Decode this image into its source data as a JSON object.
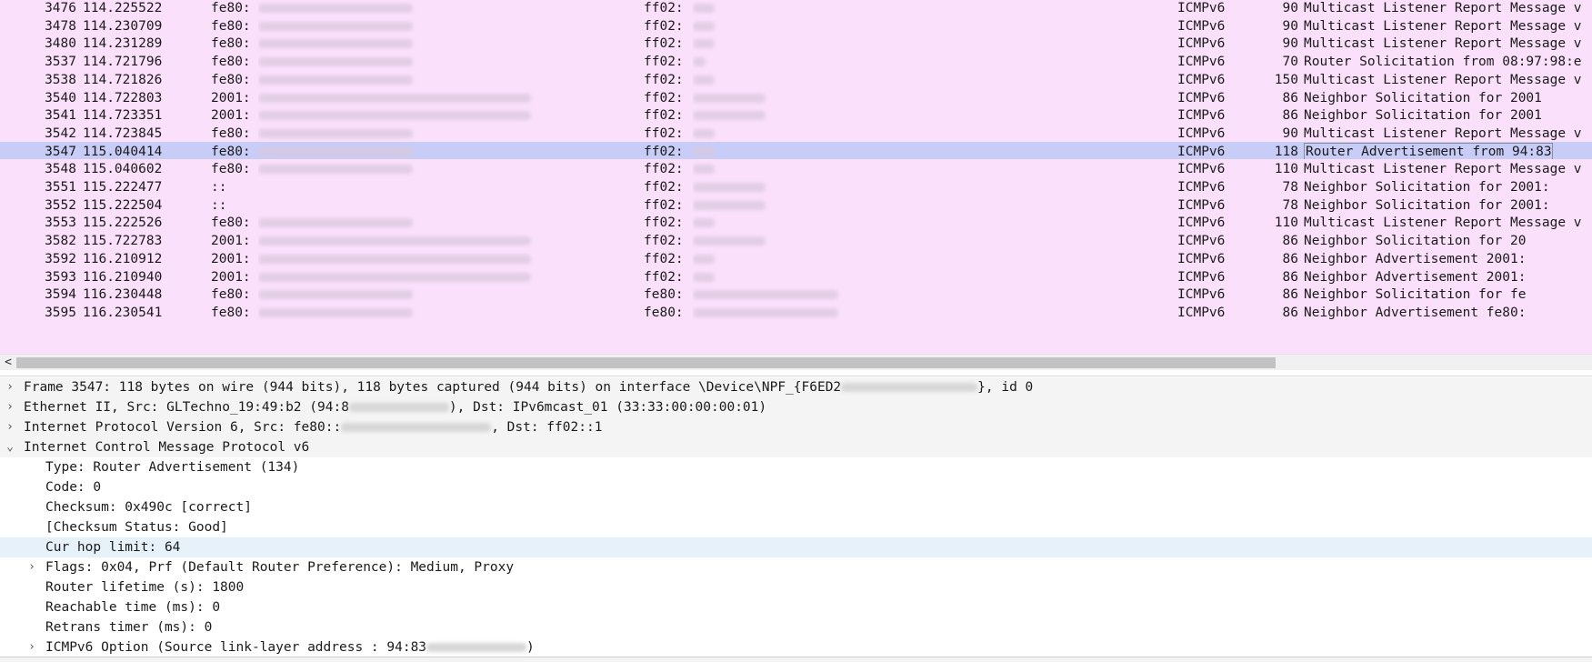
{
  "packets": [
    {
      "no": "3476",
      "time": "114.225522",
      "src": "fe80:",
      "dst": "ff02:",
      "proto": "ICMPv6",
      "len": "90",
      "info": "Multicast Listener Report Message v"
    },
    {
      "no": "3478",
      "time": "114.230709",
      "src": "fe80:",
      "dst": "ff02:",
      "proto": "ICMPv6",
      "len": "90",
      "info": "Multicast Listener Report Message v"
    },
    {
      "no": "3480",
      "time": "114.231289",
      "src": "fe80:",
      "dst": "ff02:",
      "proto": "ICMPv6",
      "len": "90",
      "info": "Multicast Listener Report Message v"
    },
    {
      "no": "3537",
      "time": "114.721796",
      "src": "fe80:",
      "dst": "ff02:",
      "proto": "ICMPv6",
      "len": "70",
      "info": "Router Solicitation from 08:97:98:e"
    },
    {
      "no": "3538",
      "time": "114.721826",
      "src": "fe80:",
      "dst": "ff02:",
      "proto": "ICMPv6",
      "len": "150",
      "info": "Multicast Listener Report Message v"
    },
    {
      "no": "3540",
      "time": "114.722803",
      "src": "2001:",
      "dst": "ff02:",
      "proto": "ICMPv6",
      "len": "86",
      "info": "Neighbor Solicitation for 2001"
    },
    {
      "no": "3541",
      "time": "114.723351",
      "src": "2001:",
      "dst": "ff02:",
      "proto": "ICMPv6",
      "len": "86",
      "info": "Neighbor Solicitation for 2001"
    },
    {
      "no": "3542",
      "time": "114.723845",
      "src": "fe80:",
      "dst": "ff02:",
      "proto": "ICMPv6",
      "len": "90",
      "info": "Multicast Listener Report Message v"
    },
    {
      "no": "3547",
      "time": "115.040414",
      "src": "fe80:",
      "dst": "ff02:",
      "proto": "ICMPv6",
      "len": "118",
      "info": "Router Advertisement from 94:83"
    },
    {
      "no": "3548",
      "time": "115.040602",
      "src": "fe80:",
      "dst": "ff02:",
      "proto": "ICMPv6",
      "len": "110",
      "info": "Multicast Listener Report Message v"
    },
    {
      "no": "3551",
      "time": "115.222477",
      "src": "::",
      "dst": "ff02:",
      "proto": "ICMPv6",
      "len": "78",
      "info": "Neighbor Solicitation for 2001:"
    },
    {
      "no": "3552",
      "time": "115.222504",
      "src": "::",
      "dst": "ff02:",
      "proto": "ICMPv6",
      "len": "78",
      "info": "Neighbor Solicitation for 2001:"
    },
    {
      "no": "3553",
      "time": "115.222526",
      "src": "fe80:",
      "dst": "ff02:",
      "proto": "ICMPv6",
      "len": "110",
      "info": "Multicast Listener Report Message v"
    },
    {
      "no": "3582",
      "time": "115.722783",
      "src": "2001:",
      "dst": "ff02:",
      "proto": "ICMPv6",
      "len": "86",
      "info": "Neighbor Solicitation for 20"
    },
    {
      "no": "3592",
      "time": "116.210912",
      "src": "2001:",
      "dst": "ff02:",
      "proto": "ICMPv6",
      "len": "86",
      "info": "Neighbor Advertisement 2001:"
    },
    {
      "no": "3593",
      "time": "116.210940",
      "src": "2001:",
      "dst": "ff02:",
      "proto": "ICMPv6",
      "len": "86",
      "info": "Neighbor Advertisement 2001:"
    },
    {
      "no": "3594",
      "time": "116.230448",
      "src": "fe80:",
      "dst": "fe80:",
      "proto": "ICMPv6",
      "len": "86",
      "info": "Neighbor Solicitation for fe"
    },
    {
      "no": "3595",
      "time": "116.230541",
      "src": "fe80:",
      "dst": "fe80:",
      "proto": "ICMPv6",
      "len": "86",
      "info": "Neighbor Advertisement fe80:"
    }
  ],
  "details": [
    {
      "level": 0,
      "expand": ">",
      "parts": [
        "Frame 3547: 118 bytes on wire (944 bits), 118 bytes captured (944 bits) on interface \\Device\\NPF_{F6ED2",
        "}, id 0"
      ]
    },
    {
      "level": 0,
      "expand": ">",
      "parts": [
        "Ethernet II, Src: GLTechno_19:49:b2 (94:8",
        "), Dst: IPv6mcast_01 (33:33:00:00:00:01)"
      ]
    },
    {
      "level": 0,
      "expand": ">",
      "parts": [
        "Internet Protocol Version 6, Src: fe80::",
        ", Dst: ff02::1"
      ]
    },
    {
      "level": 0,
      "expand": "v",
      "parts": [
        "Internet Control Message Protocol v6"
      ]
    },
    {
      "level": 1,
      "expand": "",
      "parts": [
        "Type: Router Advertisement (134)"
      ]
    },
    {
      "level": 1,
      "expand": "",
      "parts": [
        "Code: 0"
      ]
    },
    {
      "level": 1,
      "expand": "",
      "parts": [
        "Checksum: 0x490c [correct]"
      ]
    },
    {
      "level": 1,
      "expand": "",
      "parts": [
        "[Checksum Status: Good]"
      ]
    },
    {
      "level": 1,
      "expand": "",
      "parts": [
        "Cur hop limit: 64"
      ]
    },
    {
      "level": 1,
      "expand": ">",
      "parts": [
        "Flags: 0x04, Prf (Default Router Preference): Medium, Proxy"
      ]
    },
    {
      "level": 1,
      "expand": "",
      "parts": [
        "Router lifetime (s): 1800"
      ]
    },
    {
      "level": 1,
      "expand": "",
      "parts": [
        "Reachable time (ms): 0"
      ]
    },
    {
      "level": 1,
      "expand": "",
      "parts": [
        "Retrans timer (ms): 0"
      ]
    },
    {
      "level": 1,
      "expand": ">",
      "parts": [
        "ICMPv6 Option (Source link-layer address : 94:83",
        ")"
      ]
    }
  ],
  "scroll_left_icon": "<",
  "colors": {
    "row_bg": "#fbe0fb",
    "selected_bg": "#c8cdf7",
    "detail_highlight": "#e6f1fa"
  }
}
